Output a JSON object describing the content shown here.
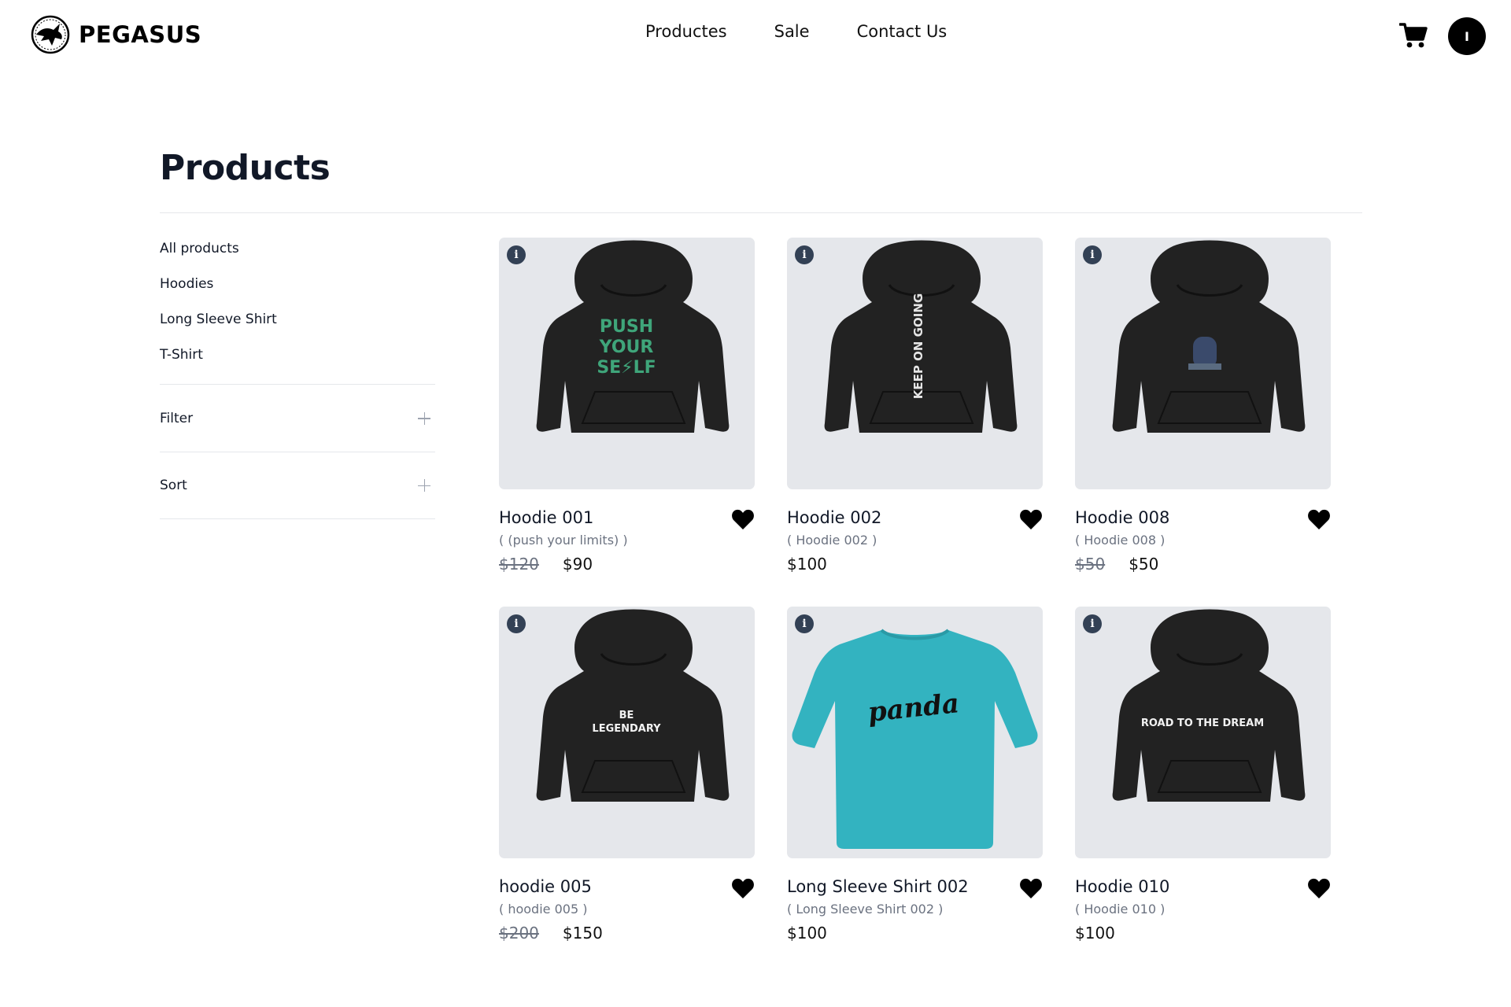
{
  "header": {
    "brand": "PEGASUS",
    "nav": [
      "Productes",
      "Sale",
      "Contact Us"
    ],
    "avatar_initial": "I"
  },
  "page": {
    "title": "Products"
  },
  "sidebar": {
    "categories": [
      "All products",
      "Hoodies",
      "Long Sleeve Shirt",
      "T-Shirt"
    ],
    "filter_label": "Filter",
    "sort_label": "Sort"
  },
  "colors": {
    "hoodie": "#222222",
    "long_sleeve": "#33b3c0",
    "card_bg": "#e5e7eb",
    "info_icon": "#334155"
  },
  "products": [
    {
      "name": "Hoodie 001",
      "subtitle": "( (push your limits) )",
      "old_price": "$120",
      "price": "$90",
      "type": "hoodie",
      "print_lines": [
        "PUSH",
        "YOUR",
        "SE⚡LF"
      ],
      "print_color": "#3fa57a"
    },
    {
      "name": "Hoodie 002",
      "subtitle": "( Hoodie 002 )",
      "old_price": "",
      "price": "$100",
      "type": "hoodie",
      "print_lines": [
        "KEEP ON GOING"
      ],
      "print_color": "#e5e5e5"
    },
    {
      "name": "Hoodie 008",
      "subtitle": "( Hoodie 008 )",
      "old_price": "$50",
      "price": "$50",
      "type": "hoodie",
      "print_lines": [
        ""
      ],
      "print_color": "#3a4a6b"
    },
    {
      "name": "hoodie 005",
      "subtitle": "( hoodie 005 )",
      "old_price": "$200",
      "price": "$150",
      "type": "hoodie",
      "print_lines": [
        "BE",
        "LEGENDARY"
      ],
      "print_color": "#f2f2f2"
    },
    {
      "name": "Long Sleeve Shirt 002",
      "subtitle": "( Long Sleeve Shirt 002 )",
      "old_price": "",
      "price": "$100",
      "type": "longsleeve",
      "print_lines": [
        "panda"
      ],
      "print_color": "#111111"
    },
    {
      "name": "Hoodie 010",
      "subtitle": "( Hoodie 010 )",
      "old_price": "",
      "price": "$100",
      "type": "hoodie",
      "print_lines": [
        "ROAD TO THE DREAM"
      ],
      "print_color": "#f2f2f2"
    }
  ],
  "icons": {
    "info": "i",
    "cart": "shopping-cart-icon",
    "heart": "heart-icon",
    "plus": "plus-icon"
  }
}
